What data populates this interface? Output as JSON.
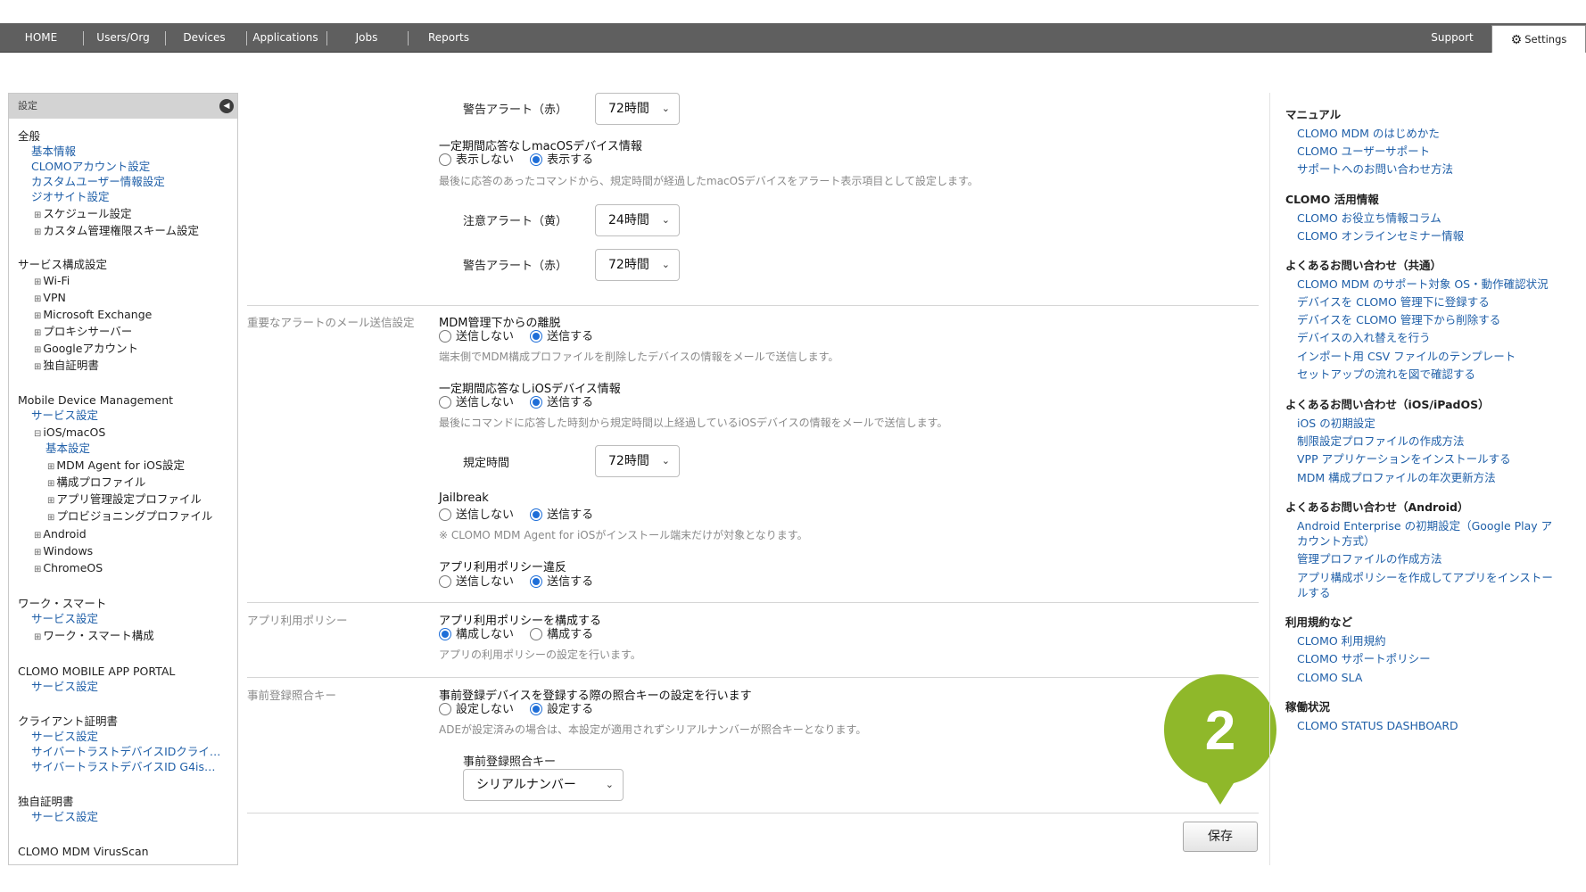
{
  "nav": {
    "items": [
      "HOME",
      "Users/Org",
      "Devices",
      "Applications",
      "Jobs",
      "Reports"
    ],
    "support": "Support",
    "settings": "Settings"
  },
  "sidebar": {
    "title": "設定",
    "general": {
      "heading": "全般",
      "links": [
        "基本情報",
        "CLOMOアカウント設定",
        "カスタムユーザー情報設定",
        "ジオサイト設定"
      ],
      "tree": [
        "スケジュール設定",
        "カスタム管理権限スキーム設定"
      ]
    },
    "service": {
      "heading": "サービス構成設定",
      "tree": [
        "Wi-Fi",
        "VPN",
        "Microsoft Exchange",
        "プロキシサーバー",
        "Googleアカウント",
        "独自証明書"
      ]
    },
    "mdm": {
      "heading": "Mobile Device Management",
      "service_link": "サービス設定",
      "ios": "iOS/macOS",
      "basic": "基本設定",
      "ios_children": [
        "MDM Agent for iOS設定",
        "構成プロファイル",
        "アプリ管理設定プロファイル",
        "プロビジョニングプロファイル"
      ],
      "others": [
        "Android",
        "Windows",
        "ChromeOS"
      ]
    },
    "work": {
      "heading": "ワーク・スマート",
      "link": "サービス設定",
      "tree": "ワーク・スマート構成"
    },
    "portal": {
      "heading": "CLOMO MOBILE APP PORTAL",
      "link": "サービス設定"
    },
    "client": {
      "heading": "クライアント証明書",
      "links": [
        "サービス設定",
        "サイバートラストデバイスIDクライ…",
        "サイバートラストデバイスID G4is…"
      ]
    },
    "own": {
      "heading": "独自証明書",
      "link": "サービス設定"
    },
    "virus": {
      "heading": "CLOMO MDM VirusScan"
    }
  },
  "main": {
    "top_alert_label": "警告アラート（赤）",
    "top_alert_value": "72時間",
    "mac_title": "一定期間応答なしmacOSデバイス情報",
    "mac_opt_off": "表示しない",
    "mac_opt_on": "表示する",
    "mac_hint": "最後に応答のあったコマンドから、規定時間が経過したmacOSデバイスをアラート表示項目として設定します。",
    "caution_label": "注意アラート（黄）",
    "caution_value": "24時間",
    "warn_label": "警告アラート（赤）",
    "warn_value": "72時間",
    "mail_section": "重要なアラートのメール送信設定",
    "leave_title": "MDM管理下からの離脱",
    "send_off": "送信しない",
    "send_on": "送信する",
    "leave_hint": "端末側でMDM構成プロファイルを削除したデバイスの情報をメールで送信します。",
    "ios_title": "一定期間応答なしiOSデバイス情報",
    "ios_hint": "最後にコマンドに応答した時刻から規定時間以上経過しているiOSデバイスの情報をメールで送信します。",
    "rule_label": "規定時間",
    "rule_value": "72時間",
    "jb_title": "Jailbreak",
    "jb_hint": "※ CLOMO MDM Agent for iOSがインストール端末だけが対象となります。",
    "policy_violation_title": "アプリ利用ポリシー違反",
    "policy_section": "アプリ利用ポリシー",
    "policy_title": "アプリ利用ポリシーを構成する",
    "policy_off": "構成しない",
    "policy_on": "構成する",
    "policy_hint": "アプリの利用ポリシーの設定を行います。",
    "pre_section": "事前登録照合キー",
    "pre_title": "事前登録デバイスを登録する際の照合キーの設定を行います",
    "pre_off": "設定しない",
    "pre_on": "設定する",
    "pre_hint": "ADEが設定済みの場合は、本設定が適用されずシリアルナンバーが照合キーとなります。",
    "pre_key_label": "事前登録照合キー",
    "pre_key_value": "シリアルナンバー",
    "save": "保存",
    "step": "2"
  },
  "right": {
    "manual": {
      "heading": "マニュアル",
      "links": [
        "CLOMO MDM のはじめかた",
        "CLOMO ユーザーサポート",
        "サポートへのお問い合わせ方法"
      ]
    },
    "info": {
      "heading": "CLOMO 活用情報",
      "links": [
        "CLOMO お役立ち情報コラム",
        "CLOMO オンラインセミナー情報"
      ]
    },
    "faq": {
      "heading": "よくあるお問い合わせ（共通）",
      "links": [
        "CLOMO MDM のサポート対象 OS・動作確認状況",
        "デバイスを CLOMO 管理下に登録する",
        "デバイスを CLOMO 管理下から削除する",
        "デバイスの入れ替えを行う",
        "インポート用 CSV ファイルのテンプレート",
        "セットアップの流れを図で確認する"
      ]
    },
    "faq_ios": {
      "heading": "よくあるお問い合わせ（iOS/iPadOS）",
      "links": [
        "iOS の初期設定",
        "制限設定プロファイルの作成方法",
        "VPP アプリケーションをインストールする",
        "MDM 構成プロファイルの年次更新方法"
      ]
    },
    "faq_android": {
      "heading": "よくあるお問い合わせ（Android）",
      "links": [
        "Android Enterprise の初期設定（Google Play ア",
        "カウント方式）",
        "管理プロファイルの作成方法",
        "アプリ構成ポリシーを作成してアプリをインストー",
        "ルする"
      ]
    },
    "terms": {
      "heading": "利用規約など",
      "links": [
        "CLOMO 利用規約",
        "CLOMO サポートポリシー",
        "CLOMO SLA"
      ]
    },
    "status": {
      "heading": "稼働状況",
      "link": "CLOMO STATUS DASHBOARD"
    }
  },
  "colors": {
    "nav_bg": "#5f5f5f",
    "link": "#1f5fa8",
    "radio_on": "#1e6ed8",
    "marker_green": "#8fb82a"
  }
}
